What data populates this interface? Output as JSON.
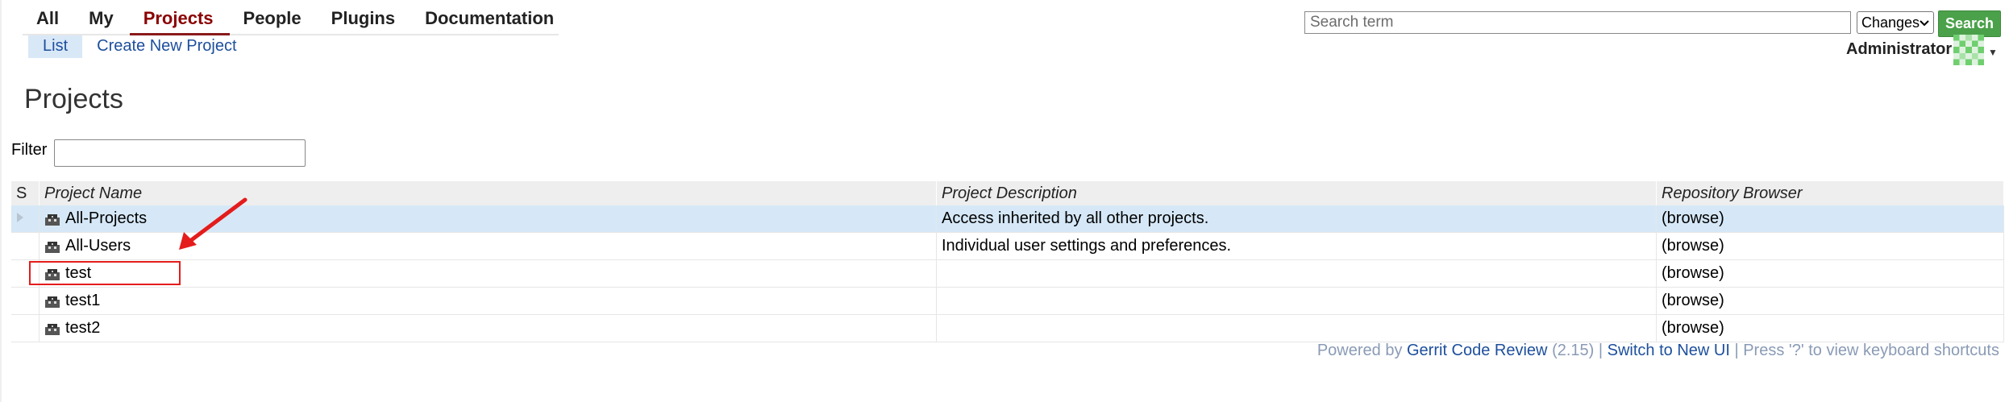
{
  "topmenu": {
    "tabs": [
      {
        "label": "All"
      },
      {
        "label": "My"
      },
      {
        "label": "Projects"
      },
      {
        "label": "People"
      },
      {
        "label": "Plugins"
      },
      {
        "label": "Documentation"
      }
    ],
    "active_tab": "Projects"
  },
  "submenu": {
    "items": [
      {
        "label": "List"
      },
      {
        "label": "Create New Project"
      }
    ],
    "active_item": "List"
  },
  "search": {
    "placeholder": "Search term",
    "scope_value": "Changes",
    "button_label": "Search"
  },
  "user": {
    "name": "Administrator"
  },
  "page": {
    "title": "Projects"
  },
  "filter": {
    "label": "Filter",
    "value": ""
  },
  "table": {
    "headers": [
      "S",
      "Project Name",
      "Project Description",
      "Repository Browser"
    ],
    "rows": [
      {
        "name": "All-Projects",
        "description": "Access inherited by all other projects.",
        "browser": "(browse)",
        "selected": true
      },
      {
        "name": "All-Users",
        "description": "Individual user settings and preferences.",
        "browser": "(browse)",
        "selected": false
      },
      {
        "name": "test",
        "description": "",
        "browser": "(browse)",
        "selected": false
      },
      {
        "name": "test1",
        "description": "",
        "browser": "(browse)",
        "selected": false
      },
      {
        "name": "test2",
        "description": "",
        "browser": "(browse)",
        "selected": false
      }
    ]
  },
  "footer": {
    "powered_by": "Powered by ",
    "gerrit_link": "Gerrit Code Review",
    "version": " (2.15) | ",
    "new_ui_link": "Switch to New UI",
    "shortcuts": " | Press '?' to view keyboard shortcuts"
  },
  "colors": {
    "accent": "#8b1a1a",
    "link": "#1d4f9d",
    "search_button": "#4aa14a",
    "selected_row": "#d6e8f7",
    "annotation_red": "#e41c1c"
  },
  "icons": {
    "project": "project-icon",
    "expand": "expand-triangle-icon",
    "avatar": "identicon-avatar",
    "dropdown": "chevron-down-icon"
  }
}
